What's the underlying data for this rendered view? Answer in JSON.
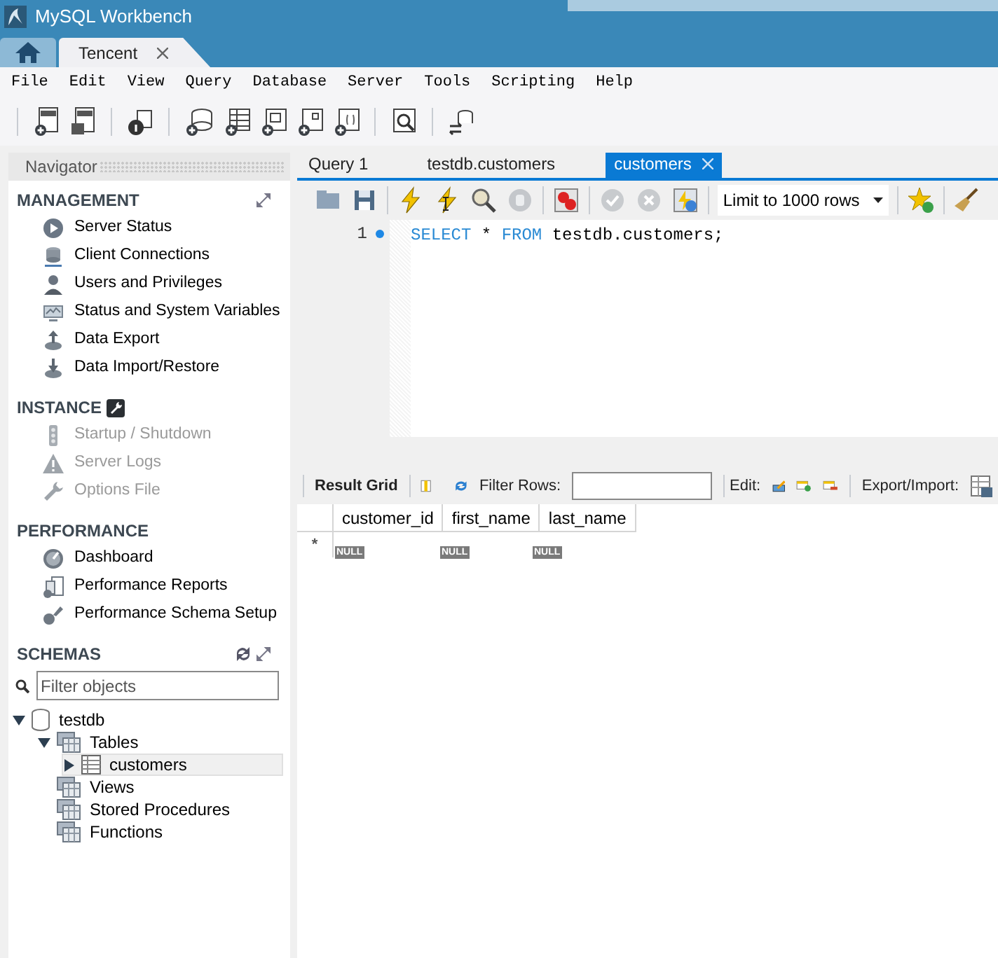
{
  "window": {
    "title": "MySQL Workbench"
  },
  "connection_tabs": [
    {
      "kind": "home",
      "selected": false
    },
    {
      "kind": "connection",
      "label": "Tencent",
      "selected": true
    }
  ],
  "menu": [
    "File",
    "Edit",
    "View",
    "Query",
    "Database",
    "Server",
    "Tools",
    "Scripting",
    "Help"
  ],
  "navigator": {
    "title": "Navigator",
    "sections": [
      {
        "title": "MANAGEMENT",
        "items": [
          {
            "label": "Server Status",
            "disabled": false
          },
          {
            "label": "Client Connections",
            "disabled": false
          },
          {
            "label": "Users and Privileges",
            "disabled": false
          },
          {
            "label": "Status and System Variables",
            "disabled": false
          },
          {
            "label": "Data Export",
            "disabled": false
          },
          {
            "label": "Data Import/Restore",
            "disabled": false
          }
        ]
      },
      {
        "title": "INSTANCE",
        "items": [
          {
            "label": "Startup / Shutdown",
            "disabled": true
          },
          {
            "label": "Server Logs",
            "disabled": true
          },
          {
            "label": "Options File",
            "disabled": true
          }
        ]
      },
      {
        "title": "PERFORMANCE",
        "items": [
          {
            "label": "Dashboard",
            "disabled": false
          },
          {
            "label": "Performance Reports",
            "disabled": false
          },
          {
            "label": "Performance Schema Setup",
            "disabled": false
          }
        ]
      }
    ],
    "schemas": {
      "title": "SCHEMAS",
      "filter": {
        "placeholder": "Filter objects"
      },
      "tree": [
        {
          "label": "testdb",
          "kind": "schema",
          "expanded": true,
          "selected": false,
          "children": [
            {
              "label": "Tables",
              "kind": "folder",
              "expanded": true,
              "selected": false,
              "children": [
                {
                  "label": "customers",
                  "kind": "table",
                  "expanded": false,
                  "selected": true
                }
              ]
            },
            {
              "label": "Views",
              "kind": "folder",
              "selected": false
            },
            {
              "label": "Stored Procedures",
              "kind": "folder",
              "selected": false
            },
            {
              "label": "Functions",
              "kind": "folder",
              "selected": false
            }
          ]
        }
      ]
    }
  },
  "query_tabs": [
    {
      "label": "Query 1",
      "selected": false
    },
    {
      "label": "testdb.customers",
      "selected": false
    },
    {
      "label": "customers",
      "selected": true
    }
  ],
  "limit": {
    "value": "Limit to 1000 rows"
  },
  "editor": {
    "lines": [
      {
        "number": "1",
        "tokens": [
          {
            "kind": "keyword",
            "text": "SELECT"
          },
          {
            "kind": "plain",
            "text": " * "
          },
          {
            "kind": "keyword",
            "text": "FROM"
          },
          {
            "kind": "plain",
            "text": " testdb.customers;"
          }
        ]
      }
    ]
  },
  "result": {
    "tab": "Result Grid",
    "filter_label": "Filter Rows:",
    "edit_label": "Edit:",
    "export_label": "Export/Import:",
    "columns": [
      "customer_id",
      "first_name",
      "last_name"
    ],
    "rows": [
      {
        "marker": "*",
        "cells": [
          "NULL",
          "NULL",
          "NULL"
        ]
      }
    ]
  }
}
